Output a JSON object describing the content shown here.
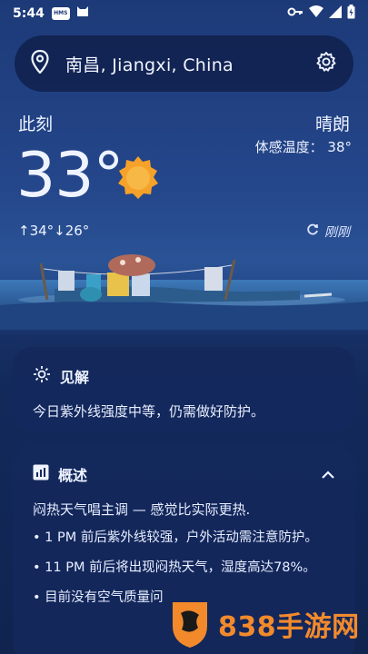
{
  "status": {
    "time": "5:44",
    "hms_badge": "HMS"
  },
  "search": {
    "location": "南昌, Jiangxi, China"
  },
  "current": {
    "label": "此刻",
    "condition": "晴朗",
    "feels_like": "体感温度：  38°",
    "temperature": "33°",
    "high_low": "↑34°↓26°",
    "updated": "刚刚"
  },
  "insight": {
    "title": "见解",
    "text": "今日紫外线强度中等，仍需做好防护。"
  },
  "overview": {
    "title": "概述",
    "lead": "闷热天气唱主调 — 感觉比实际更热.",
    "items": [
      "• 1 PM 前后紫外线较强，户外活动需注意防护。",
      "• 11 PM 前后将出现闷热天气，湿度高达78%。",
      "• 目前没有空气质量问"
    ]
  },
  "watermark": {
    "text": "838手游网"
  },
  "colors": {
    "sun": "#f5a12a",
    "card": "#14285c",
    "accent": "#f28a2c"
  }
}
